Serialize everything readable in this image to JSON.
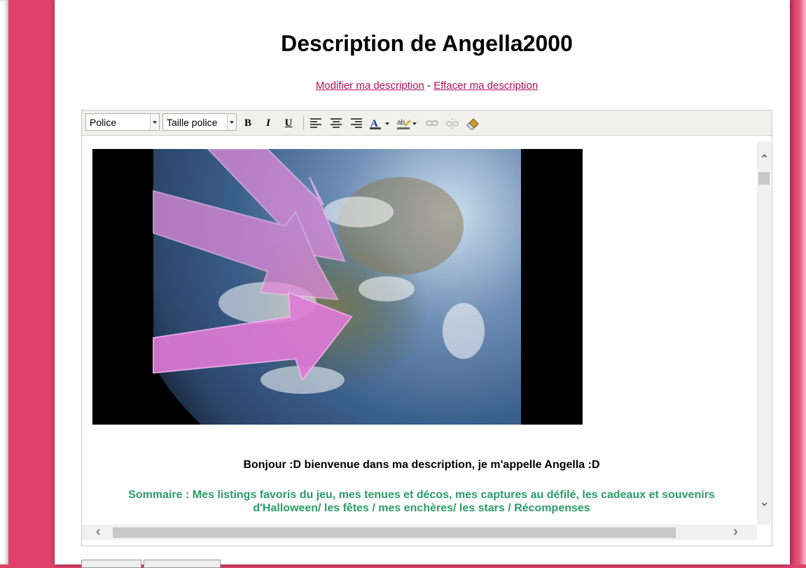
{
  "page": {
    "title": "Description de Angella2000",
    "links": {
      "edit": "Modifier ma description",
      "separator": "-",
      "delete": "Effacer ma description"
    }
  },
  "editor": {
    "toolbar": {
      "font_select": "Police",
      "size_select": "Taille police",
      "bold": "B",
      "italic": "I",
      "underline": "U"
    },
    "content": {
      "greeting": "Bonjour :D bienvenue dans ma description, je m'appelle Angella :D",
      "summary": "Sommaire : Mes listings favoris du jeu, mes tenues et décos, mes captures au défilé, les cadeaux et souvenirs d'Halloween/ les fêtes / mes enchères/ les stars / Récompenses"
    }
  },
  "colors": {
    "background": "#e0406a",
    "link": "#b0105a",
    "summary": "#2c9c6a"
  },
  "icons": [
    "align-left-icon",
    "align-center-icon",
    "align-right-icon",
    "text-color-icon",
    "highlight-icon",
    "link-icon",
    "unlink-icon",
    "eraser-icon"
  ]
}
